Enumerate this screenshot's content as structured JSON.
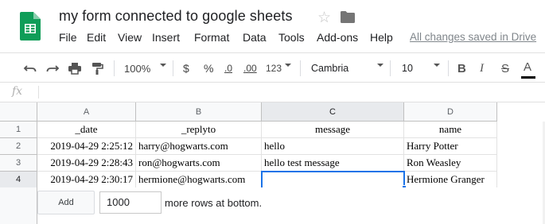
{
  "doc": {
    "title": "my form connected to google sheets",
    "save_status": "All changes saved in Drive",
    "logo_icon": "sheets-logo-icon",
    "colors": {
      "brand": "#0f9d58",
      "selection": "#1a73e8"
    }
  },
  "menu": [
    "File",
    "Edit",
    "View",
    "Insert",
    "Format",
    "Data",
    "Tools",
    "Add-ons",
    "Help"
  ],
  "toolbar": {
    "zoom": "100%",
    "currency": "$",
    "percent": "%",
    "decrease_decimals": ".0",
    "increase_decimals": ".00",
    "more_formats": "123",
    "font": "Cambria",
    "font_size": "10",
    "bold": "B",
    "italic": "I",
    "strikethrough": "S",
    "text_color": "A"
  },
  "formula_bar": {
    "label": "fx",
    "value": ""
  },
  "sheet": {
    "columns": [
      "A",
      "B",
      "C",
      "D"
    ],
    "row_numbers": [
      "1",
      "2",
      "3",
      "4"
    ],
    "rows": [
      [
        "_date",
        "_replyto",
        "message",
        "name"
      ],
      [
        "2019-04-29 2:25:12",
        "harry@hogwarts.com",
        "hello",
        "Harry Potter"
      ],
      [
        "2019-04-29 2:28:43",
        "ron@hogwarts.com",
        "hello test message",
        "Ron Weasley"
      ],
      [
        "2019-04-29 2:30:17",
        "hermione@hogwarts.com",
        "",
        "Hermione Granger"
      ]
    ],
    "active_cell": "C4"
  },
  "add_rows": {
    "button_label": "Add",
    "count": "1000",
    "suffix": "more rows at bottom."
  }
}
